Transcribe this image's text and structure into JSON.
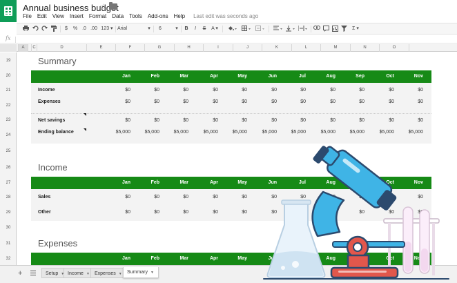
{
  "app": {
    "title": "Annual business budget",
    "last_edit": "Last edit was seconds ago",
    "menu": [
      "File",
      "Edit",
      "View",
      "Insert",
      "Format",
      "Data",
      "Tools",
      "Add-ons",
      "Help"
    ]
  },
  "toolbar": {
    "currency": "$",
    "percent": "%",
    "decimal_less": ".0",
    "decimal_more": ".00",
    "more_formats": "123",
    "font": "Arial",
    "font_size": "6",
    "bold": "B",
    "italic": "I",
    "strike": "S",
    "text_color": "A",
    "sum": "Σ"
  },
  "formula_bar": {
    "fx": "fx"
  },
  "columns": [
    "A",
    "B",
    "C",
    "D",
    "E",
    "F",
    "G",
    "H",
    "I",
    "J",
    "K",
    "L",
    "M",
    "N",
    "O"
  ],
  "rows": [
    "19",
    "20",
    "21",
    "22",
    "23",
    "24",
    "25",
    "26",
    "27",
    "28",
    "29",
    "30",
    "31",
    "32"
  ],
  "months": [
    "Jan",
    "Feb",
    "Mar",
    "Apr",
    "May",
    "Jun",
    "Jul",
    "Aug",
    "Sep",
    "Oct",
    "Nov"
  ],
  "summary": {
    "title": "Summary",
    "rows": [
      {
        "label": "Income",
        "values": [
          "$0",
          "$0",
          "$0",
          "$0",
          "$0",
          "$0",
          "$0",
          "$0",
          "$0",
          "$0",
          "$0"
        ]
      },
      {
        "label": "Expenses",
        "values": [
          "$0",
          "$0",
          "$0",
          "$0",
          "$0",
          "$0",
          "$0",
          "$0",
          "$0",
          "$0",
          "$0"
        ]
      },
      {
        "label": "Net savings",
        "values": [
          "$0",
          "$0",
          "$0",
          "$0",
          "$0",
          "$0",
          "$0",
          "$0",
          "$0",
          "$0",
          "$0"
        ]
      },
      {
        "label": "Ending balance",
        "values": [
          "$5,000",
          "$5,000",
          "$5,000",
          "$5,000",
          "$5,000",
          "$5,000",
          "$5,000",
          "$5,000",
          "$5,000",
          "$5,000",
          "$5,000"
        ]
      }
    ]
  },
  "income": {
    "title": "Income",
    "rows": [
      {
        "label": "Sales",
        "values": [
          "$0",
          "$0",
          "$0",
          "$0",
          "$0",
          "$0",
          "$0",
          "$0",
          "$0",
          "$0",
          "$0"
        ]
      },
      {
        "label": "Other",
        "values": [
          "$0",
          "$0",
          "$0",
          "$0",
          "$0",
          "$0",
          "$0",
          "$0",
          "$0",
          "$0",
          "$0"
        ]
      }
    ]
  },
  "expenses": {
    "title": "Expenses"
  },
  "sheet_tabs": [
    {
      "label": "Setup"
    },
    {
      "label": "Income"
    },
    {
      "label": "Expenses"
    },
    {
      "label": "Summary"
    }
  ],
  "colors": {
    "brand": "#0f9d58",
    "header_band": "#168a16",
    "row_band": "#f3f3f3",
    "illustration_blue": "#3fb4e6",
    "illustration_red": "#e2574c"
  }
}
